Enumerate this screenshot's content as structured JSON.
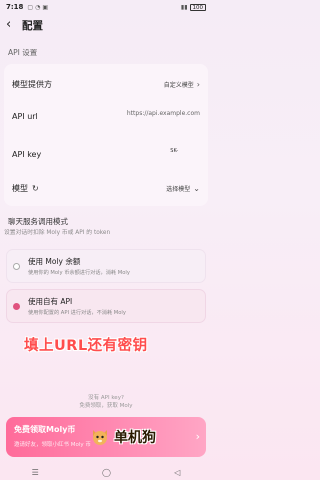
{
  "status_bar": {
    "time": "7:18",
    "battery": "100",
    "icons": [
      "sim-icon",
      "wifi-icon",
      "screen-icon",
      "signal-icon"
    ]
  },
  "header": {
    "title": "配置",
    "back_icon": "back-arrow-icon"
  },
  "api_settings": {
    "section_title": "API 设置",
    "rows": {
      "provider": {
        "label": "模型提供方",
        "value": "自定义模型"
      },
      "api_url": {
        "label": "API url",
        "placeholder": "https://api.example.com"
      },
      "api_key": {
        "label": "API key",
        "value": "SK-"
      },
      "model": {
        "label": "模型",
        "value": "选择模型"
      }
    }
  },
  "chat_mode": {
    "section_title": "聊天服务调用模式",
    "subtitle": "设置对话时扣除 Moly 币或 API 的 token",
    "options": [
      {
        "title": "使用 Moly 余额",
        "desc": "使用你的 Moly 币余额进行对话，消耗 Moly",
        "selected": false
      },
      {
        "title": "使用自有 API",
        "desc": "使用你配置的 API 进行对话，不消耗 Moly",
        "selected": true
      }
    ]
  },
  "overlay_annotation": "填上URL还有密钥",
  "hint": {
    "line1": "没有 API key?",
    "line2": "免费领取，获取 Moly"
  },
  "promo": {
    "title": "免费领取Moly币",
    "desc": "邀请好友，领取小红书 Moly 币",
    "chevron_icon": "chevron-right-icon"
  },
  "watermark": "单机狗",
  "navbar": [
    "recent-apps-icon",
    "home-icon",
    "back-icon"
  ],
  "colors": {
    "accent": "#e0527e",
    "overlay_text": "#ff4d4d",
    "promo_gradient_start": "#ff6b9a"
  }
}
